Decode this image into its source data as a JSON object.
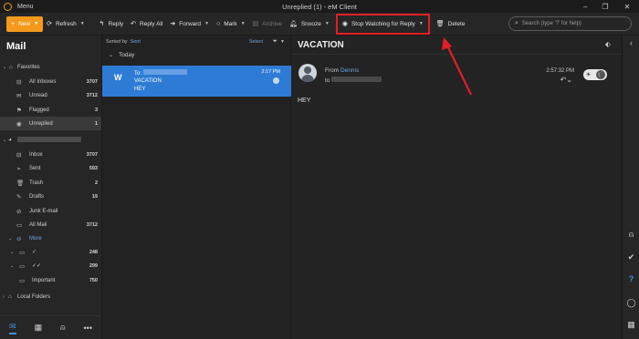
{
  "window": {
    "title": "Unreplied (1) - eM Client",
    "menu_label": "Menu",
    "min": "–",
    "max": "❐",
    "close": "✕"
  },
  "toolbar": {
    "new": "New",
    "refresh": "Refresh",
    "reply": "Reply",
    "reply_all": "Reply All",
    "forward": "Forward",
    "mark": "Mark",
    "archive": "Archive",
    "snooze": "Snooze",
    "stop_watching": "Stop Watching for Reply",
    "delete": "Delete",
    "search_placeholder": "Search (type '?' for help)"
  },
  "sidebar": {
    "title": "Mail",
    "favorites_label": "Favorites",
    "favorites": [
      {
        "label": "All Inboxes",
        "count": "3707"
      },
      {
        "label": "Unread",
        "count": "3712"
      },
      {
        "label": "Flagged",
        "count": "3"
      },
      {
        "label": "Unreplied",
        "count": "1"
      }
    ],
    "account_folders": [
      {
        "label": "Inbox",
        "count": "3707"
      },
      {
        "label": "Sent",
        "count": "593"
      },
      {
        "label": "Trash",
        "count": "2"
      },
      {
        "label": "Drafts",
        "count": "19"
      },
      {
        "label": "Junk E-mail",
        "count": ""
      },
      {
        "label": "All Mail",
        "count": "3712"
      }
    ],
    "more_label": "More",
    "more_items": [
      {
        "label": "✓",
        "count": "248"
      },
      {
        "label": "✓✓",
        "count": "299"
      },
      {
        "label": "Important",
        "count": "750"
      }
    ],
    "local_folders": "Local Folders"
  },
  "list": {
    "sorted_by": "Sorted by",
    "sort_field": "Sent",
    "select": "Select",
    "group": "Today",
    "message": {
      "avatar": "W",
      "to": "To:",
      "subject": "VACATION",
      "preview": "HEY",
      "time": "2:17 PM"
    }
  },
  "reader": {
    "subject": "VACATION",
    "from_label": "From",
    "from_name": "Dennis",
    "to_label": "to",
    "time": "2:57:32 PM",
    "body": "HEY"
  },
  "colors": {
    "accent": "#f39a1d",
    "selection": "#2e7bd6",
    "link": "#6aa7e8",
    "highlight": "#e41e26"
  }
}
